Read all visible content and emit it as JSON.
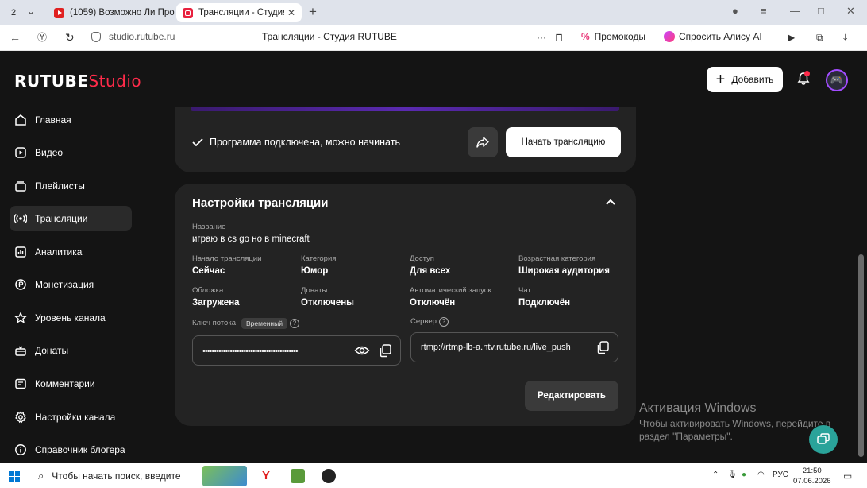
{
  "browser": {
    "tab_counter": "2",
    "tabs": [
      {
        "title": "(1059) Возможно Ли Про"
      },
      {
        "title": "Трансляции - Студия R"
      }
    ],
    "address": "studio.rutube.ru",
    "page_title": "Трансляции - Студия RUTUBE",
    "promo_label": "Промокоды",
    "alice_label": "Спросить Алису AI"
  },
  "header": {
    "logo_main": "RUTUBE",
    "logo_studio": "Studio",
    "add_label": "Добавить"
  },
  "sidebar": {
    "items": [
      {
        "label": "Главная",
        "icon": "home-icon"
      },
      {
        "label": "Видео",
        "icon": "video-icon"
      },
      {
        "label": "Плейлисты",
        "icon": "playlist-icon"
      },
      {
        "label": "Трансляции",
        "icon": "broadcast-icon",
        "active": true
      },
      {
        "label": "Аналитика",
        "icon": "analytics-icon"
      },
      {
        "label": "Монетизация",
        "icon": "coin-icon"
      },
      {
        "label": "Уровень канала",
        "icon": "star-icon"
      },
      {
        "label": "Донаты",
        "icon": "gift-icon"
      },
      {
        "label": "Комментарии",
        "icon": "comment-icon"
      },
      {
        "label": "Настройки канала",
        "icon": "gear-icon"
      },
      {
        "label": "Справочник блогера",
        "icon": "info-icon"
      }
    ]
  },
  "stream_status": {
    "message": "Программа подключена, можно начинать",
    "start_label": "Начать трансляцию"
  },
  "settings": {
    "title": "Настройки трансляции",
    "name_label": "Название",
    "name_value": "играю в cs go но в minecraft",
    "fields": [
      {
        "label": "Начало трансляции",
        "value": "Сейчас"
      },
      {
        "label": "Категория",
        "value": "Юмор"
      },
      {
        "label": "Доступ",
        "value": "Для всех"
      },
      {
        "label": "Возрастная категория",
        "value": "Широкая аудитория"
      },
      {
        "label": "Обложка",
        "value": "Загружена"
      },
      {
        "label": "Донаты",
        "value": "Отключены"
      },
      {
        "label": "Автоматический запуск",
        "value": "Отключён"
      },
      {
        "label": "Чат",
        "value": "Подключён"
      }
    ],
    "key_label": "Ключ потока",
    "key_badge": "Временный",
    "key_value": "••••••••••••••••••••••••••••••••••••••••••",
    "server_label": "Сервер",
    "server_value": "rtmp://rtmp-lb-a.ntv.rutube.ru/live_push",
    "edit_label": "Редактировать"
  },
  "watermark": {
    "title": "Активация Windows",
    "text": "Чтобы активировать Windows, перейдите в раздел \"Параметры\"."
  },
  "taskbar": {
    "search_placeholder": "Чтобы начать поиск, введите",
    "lang": "РУС",
    "time": "21:50",
    "date": "07.06.2026"
  },
  "colors": {
    "accent": "#ff2b4a",
    "background": "#141414",
    "card": "#232323",
    "active_item": "#2a2a2a",
    "purple_bar": "#5a2ab0"
  }
}
